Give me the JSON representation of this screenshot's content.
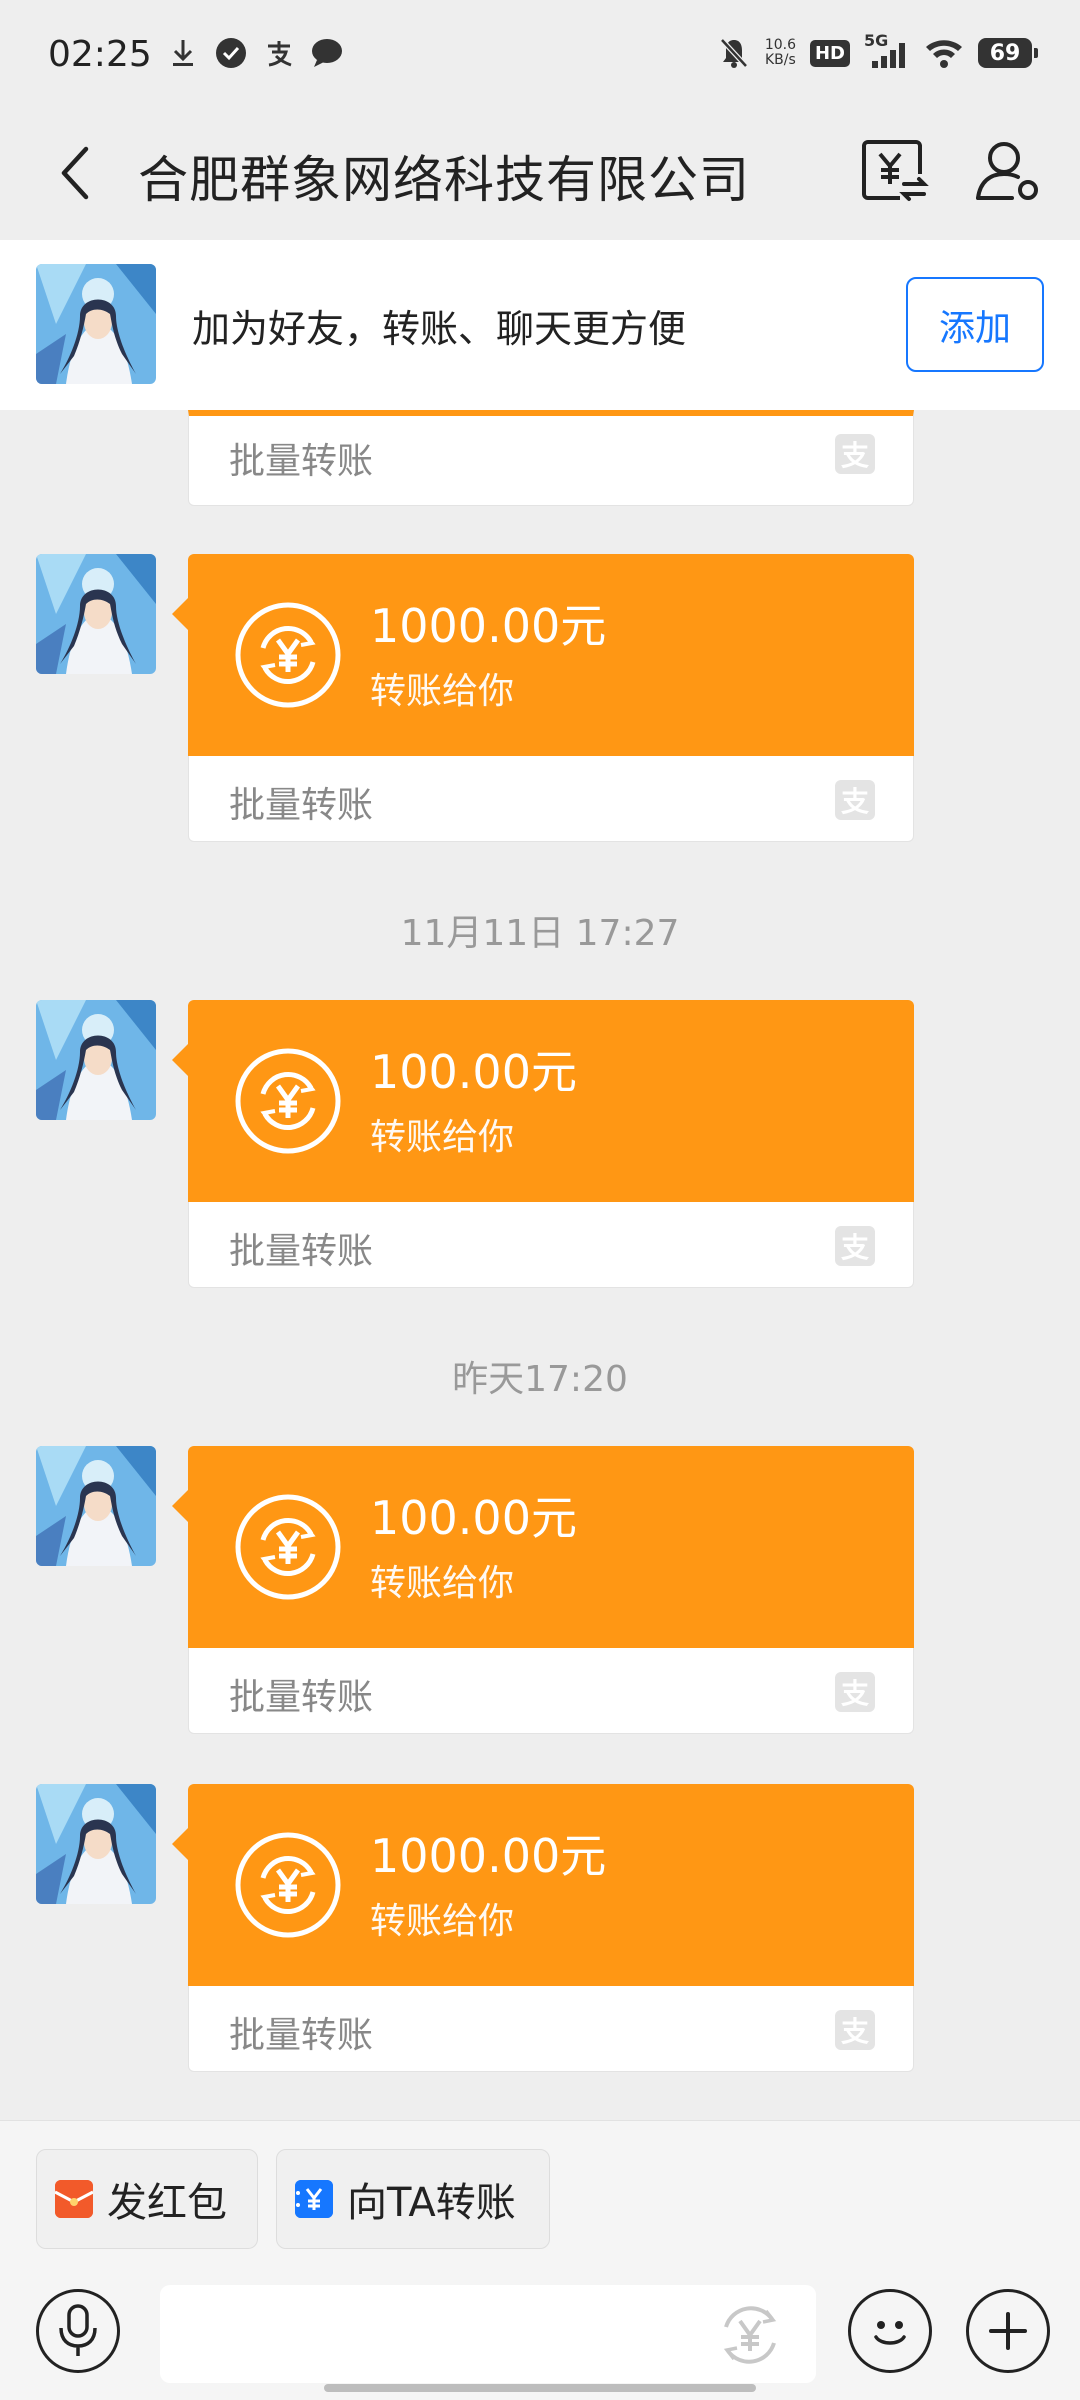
{
  "status_bar": {
    "time": "02:25",
    "net_speed_value": "10.6",
    "net_speed_unit": "KB/s",
    "hd_label": "HD",
    "network_label": "5G",
    "battery": "69",
    "left_icons": [
      "download-icon",
      "check-circle-icon",
      "alipay-icon",
      "chat-bubble-icon"
    ],
    "right_icons": [
      "mute-bell-icon",
      "signal-icon",
      "wifi-icon",
      "battery-icon"
    ]
  },
  "nav": {
    "title": "合肥群象网络科技有限公司",
    "icons": [
      "back-arrow-icon",
      "transfer-icon",
      "profile-settings-icon"
    ]
  },
  "add_friend": {
    "text": "加为好友，转账、聊天更方便",
    "button_label": "添加"
  },
  "messages": [
    {
      "type": "partial",
      "footer": "批量转账"
    },
    {
      "type": "transfer",
      "amount": "1000.00元",
      "subtitle": "转账给你",
      "footer": "批量转账"
    },
    {
      "type": "time",
      "text": "11月11日 17:27"
    },
    {
      "type": "transfer",
      "amount": "100.00元",
      "subtitle": "转账给你",
      "footer": "批量转账"
    },
    {
      "type": "time",
      "text": "昨天17:20"
    },
    {
      "type": "transfer",
      "amount": "100.00元",
      "subtitle": "转账给你",
      "footer": "批量转账"
    },
    {
      "type": "transfer",
      "amount": "1000.00元",
      "subtitle": "转账给你",
      "footer": "批量转账"
    }
  ],
  "alipay_mark": "支",
  "bottom": {
    "red_packet_label": "发红包",
    "transfer_label": "向TA转账",
    "input_placeholder": "",
    "transfer_icon_glyph": "¥"
  },
  "colors": {
    "transfer_orange": "#FF9714",
    "accent_blue": "#1677FF",
    "background": "#EEEEEE"
  }
}
